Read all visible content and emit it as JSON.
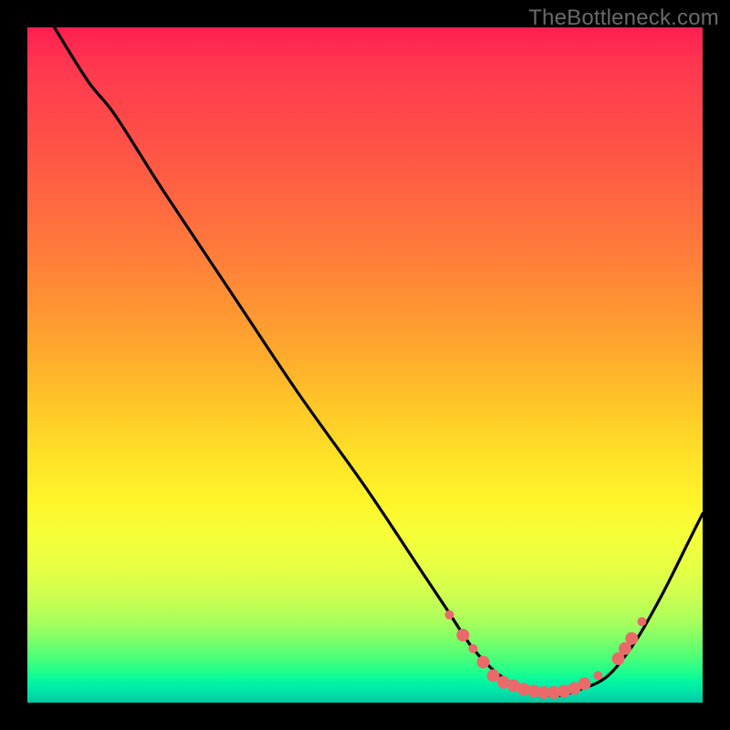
{
  "watermark": "TheBottleneck.com",
  "chart_data": {
    "type": "line",
    "title": "",
    "xlabel": "",
    "ylabel": "",
    "xlim": [
      0,
      100
    ],
    "ylim": [
      0,
      100
    ],
    "curve": {
      "name": "bottleneck-curve",
      "points": [
        {
          "x": 4,
          "y": 100
        },
        {
          "x": 9,
          "y": 92
        },
        {
          "x": 13,
          "y": 87
        },
        {
          "x": 20,
          "y": 76
        },
        {
          "x": 30,
          "y": 61
        },
        {
          "x": 40,
          "y": 46
        },
        {
          "x": 50,
          "y": 32
        },
        {
          "x": 58,
          "y": 20
        },
        {
          "x": 62,
          "y": 14
        },
        {
          "x": 66,
          "y": 8
        },
        {
          "x": 70,
          "y": 4
        },
        {
          "x": 74,
          "y": 2
        },
        {
          "x": 78,
          "y": 1
        },
        {
          "x": 82,
          "y": 2
        },
        {
          "x": 86,
          "y": 4
        },
        {
          "x": 90,
          "y": 9
        },
        {
          "x": 94,
          "y": 16
        },
        {
          "x": 98,
          "y": 24
        },
        {
          "x": 100,
          "y": 28
        }
      ]
    },
    "highlight_dots": {
      "color": "#ea6a6a",
      "radius_small": 5,
      "radius_large": 7,
      "points": [
        {
          "x": 62.5,
          "y": 13,
          "r": "small"
        },
        {
          "x": 64.5,
          "y": 10,
          "r": "large"
        },
        {
          "x": 66.0,
          "y": 8,
          "r": "small"
        },
        {
          "x": 67.5,
          "y": 6,
          "r": "large"
        },
        {
          "x": 69.0,
          "y": 4,
          "r": "large"
        },
        {
          "x": 70.5,
          "y": 3,
          "r": "large"
        },
        {
          "x": 72.0,
          "y": 2.5,
          "r": "large"
        },
        {
          "x": 73.5,
          "y": 2,
          "r": "large"
        },
        {
          "x": 75.0,
          "y": 1.7,
          "r": "large"
        },
        {
          "x": 76.5,
          "y": 1.5,
          "r": "large"
        },
        {
          "x": 78.0,
          "y": 1.5,
          "r": "large"
        },
        {
          "x": 79.5,
          "y": 1.7,
          "r": "large"
        },
        {
          "x": 81.0,
          "y": 2.1,
          "r": "large"
        },
        {
          "x": 82.5,
          "y": 2.8,
          "r": "large"
        },
        {
          "x": 84.5,
          "y": 4.0,
          "r": "small"
        },
        {
          "x": 87.5,
          "y": 6.5,
          "r": "large"
        },
        {
          "x": 88.5,
          "y": 8.0,
          "r": "large"
        },
        {
          "x": 89.5,
          "y": 9.5,
          "r": "large"
        },
        {
          "x": 91.0,
          "y": 12.0,
          "r": "small"
        }
      ]
    },
    "colors": {
      "curve": "#000000",
      "dot": "#ea6a6a",
      "background_frame": "#000000"
    }
  }
}
